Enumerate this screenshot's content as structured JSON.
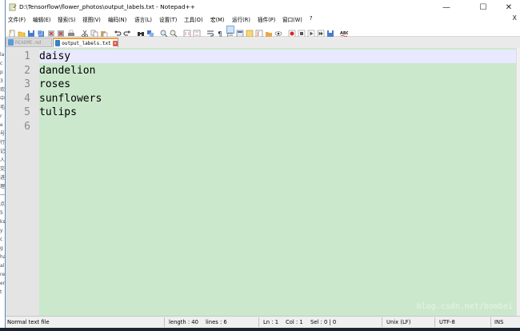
{
  "window": {
    "title": "D:\\Tensorflow\\flower_photos\\output_labels.txt - Notepad++",
    "minimize": "—",
    "maximize": "☐",
    "close": "✕"
  },
  "menu": {
    "items": [
      "文件(F)",
      "编辑(E)",
      "搜索(S)",
      "视图(V)",
      "编码(N)",
      "语言(L)",
      "设置(T)",
      "工具(O)",
      "宏(M)",
      "运行(R)",
      "插件(P)",
      "窗口(W)",
      "?"
    ],
    "close_doc": "X"
  },
  "tabs": [
    {
      "label": "README.md",
      "active": false
    },
    {
      "label": "output_labels.txt",
      "active": true
    }
  ],
  "editor": {
    "line_numbers": [
      "1",
      "2",
      "3",
      "4",
      "5",
      "6"
    ],
    "lines": [
      "daisy",
      "dandelion",
      "roses",
      "sunflowers",
      "tulips",
      ""
    ],
    "background": "#cbe8cc",
    "current_line_bg": "#e8e8ff"
  },
  "watermark": "blog.csdn.net/bombei",
  "status": {
    "file_type": "Normal text file",
    "length": "length : 40",
    "lines": "lines : 6",
    "ln": "Ln : 1",
    "col": "Col : 1",
    "sel": "Sel : 0 | 0",
    "eol": "Unix (LF)",
    "encoding": "UTF-8",
    "mode": "INS"
  },
  "background_window_chars": [
    "la",
    "c",
    "p",
    "3",
    "欢",
    "中",
    "毛",
    "r",
    "e",
    "号",
    "行",
    "记",
    "人",
    "交",
    "进",
    "理",
    "一",
    "点",
    "5",
    "ks",
    "y",
    "c",
    "g",
    "ha",
    "al",
    "re",
    "en",
    "t"
  ]
}
